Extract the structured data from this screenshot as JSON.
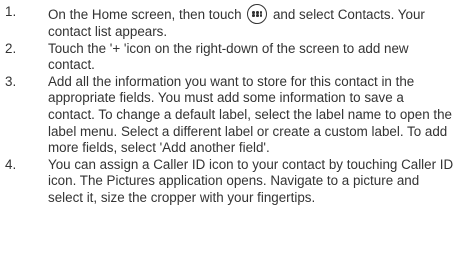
{
  "steps": [
    {
      "number": "1.",
      "text_before_icon": "On the Home screen, then touch ",
      "icon": "apps-grid-icon",
      "text_after_icon": " and select Contacts. Your contact list appears."
    },
    {
      "number": "2.",
      "text": "Touch the '+ 'icon on the right-down of the screen to add new contact."
    },
    {
      "number": "3.",
      "text": "Add all the information you want to store for this contact in the appropriate fields. You must add some information to save a contact. To change a default label, select the label name to open the label menu. Select a different label or create a custom label. To add more fields, select 'Add another field'."
    },
    {
      "number": "4.",
      "text": "You can assign a Caller ID icon to your contact by touching Caller ID icon. The Pictures application opens. Navigate to a picture and select it, size the cropper with your fingertips."
    }
  ]
}
